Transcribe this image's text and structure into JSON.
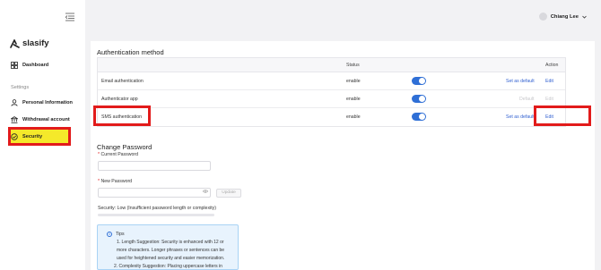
{
  "app": {
    "brand": "slasify"
  },
  "sidebar": {
    "dashboard": "Dashboard",
    "section_label": "Settings",
    "items": [
      {
        "label": "Personal Information"
      },
      {
        "label": "Withdrawal account"
      },
      {
        "label": "Security"
      }
    ],
    "active": "Security"
  },
  "header": {
    "user_name": "Chiang Lee"
  },
  "auth": {
    "title": "Authentication method",
    "columns": {
      "status": "Status",
      "action": "Action"
    },
    "rows": [
      {
        "method": "Email authentication",
        "status": "enable",
        "set_default": "Set as default",
        "edit": "Edit",
        "enabled": true
      },
      {
        "method": "Authenticator app",
        "status": "enable",
        "set_default": "Default",
        "edit": "Edit",
        "enabled": true
      },
      {
        "method": "SMS authentication",
        "status": "enable",
        "set_default": "Set as default",
        "edit": "Edit",
        "enabled": true
      }
    ]
  },
  "password": {
    "title": "Change Password",
    "current_label": "Current Password",
    "new_label": "New Password",
    "update_label": "Update",
    "security_text": "Security: Low (Insufficient password length or complexity)"
  },
  "tips": {
    "title": "Tips",
    "lines": [
      "1. Length Suggestion: Security is enhanced with 12 or",
      "more characters. Longer phrases or sentences can be",
      "used for heightened security and easier memorization.",
      "2. Complexity Suggestion: Placing uppercase letters in"
    ]
  },
  "colors": {
    "accent": "#2f6fd6",
    "highlight": "#e21b1b",
    "active_nav": "#f5e92a"
  }
}
